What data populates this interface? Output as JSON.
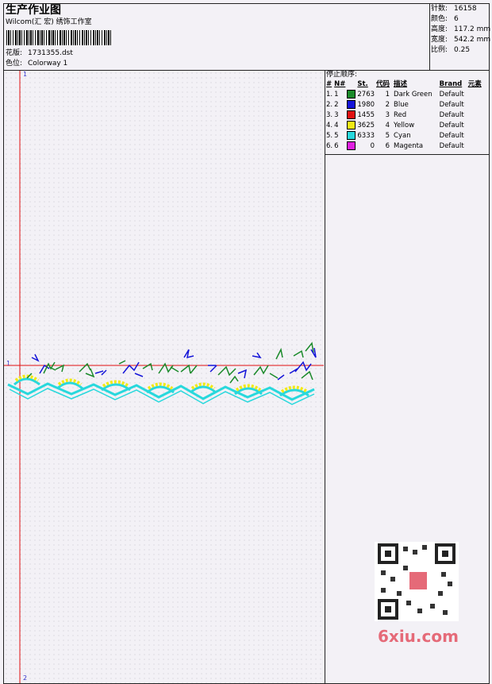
{
  "header": {
    "title": "生产作业图",
    "company": "Wilcom(汇 宏) 绣饰工作室",
    "design_label": "花版:",
    "design_value": "1731355.dst",
    "colorway_label": "色位:",
    "colorway_value": "Colorway 1"
  },
  "stats": {
    "stitches_label": "针数:",
    "stitches": "16158",
    "colors_label": "颜色:",
    "colors": "6",
    "height_label": "高度:",
    "height": "117.2 mm",
    "width_label": "宽度:",
    "width": "542.2 mm",
    "scale_label": "比例:",
    "scale": "0.25"
  },
  "stop_sequence": {
    "title": "停止顺序:",
    "headers": [
      "#",
      "N#",
      "St.",
      "代码",
      "描述",
      "Brand",
      "元素"
    ],
    "rows": [
      {
        "idx": "1.",
        "n": "1",
        "color": "#1a8a2a",
        "st": "2763",
        "code": "1",
        "desc": "Dark Green",
        "brand": "Default"
      },
      {
        "idx": "2.",
        "n": "2",
        "color": "#1414d8",
        "st": "1980",
        "code": "2",
        "desc": "Blue",
        "brand": "Default"
      },
      {
        "idx": "3.",
        "n": "3",
        "color": "#e01010",
        "st": "1455",
        "code": "3",
        "desc": "Red",
        "brand": "Default"
      },
      {
        "idx": "4.",
        "n": "4",
        "color": "#f2ea14",
        "st": "3625",
        "code": "4",
        "desc": "Yellow",
        "brand": "Default"
      },
      {
        "idx": "5.",
        "n": "5",
        "color": "#28d8dc",
        "st": "6333",
        "code": "5",
        "desc": "Cyan",
        "brand": "Default"
      },
      {
        "idx": "6.",
        "n": "6",
        "color": "#e020e0",
        "st": "0",
        "code": "6",
        "desc": "Magenta",
        "brand": "Default"
      }
    ]
  },
  "markers": {
    "top": "1",
    "left": "1",
    "bottom": "2"
  },
  "watermark": {
    "site": "6xiu.com"
  }
}
